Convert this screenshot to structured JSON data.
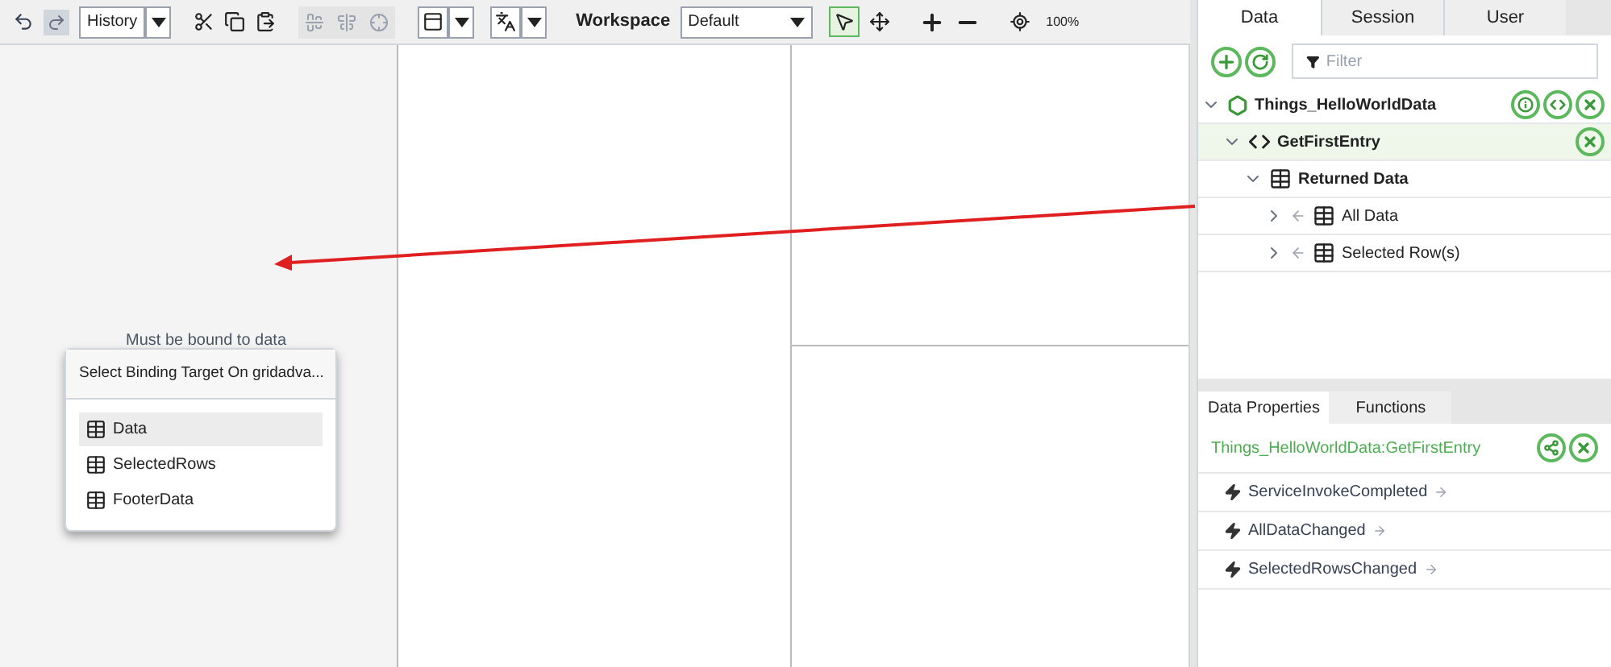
{
  "toolbar": {
    "history": "History",
    "workspace_label": "Workspace",
    "workspace": "Default",
    "zoom": "100%"
  },
  "canvas": {
    "grid_message": "Must be bound to data",
    "binding_popup": {
      "title": "Select Binding Target On gridadva...",
      "items": [
        {
          "label": "Data",
          "selected": true
        },
        {
          "label": "SelectedRows",
          "selected": false
        },
        {
          "label": "FooterData",
          "selected": false
        }
      ]
    }
  },
  "data_panel": {
    "tabs": [
      {
        "label": "Data",
        "selected": true
      },
      {
        "label": "Session",
        "selected": false
      },
      {
        "label": "User",
        "selected": false
      }
    ],
    "filter": {
      "placeholder": "Filter"
    },
    "tree": [
      {
        "label": "Things_HelloWorldData",
        "kind": "thing",
        "expanded": true,
        "children": [
          {
            "label": "GetFirstEntry",
            "kind": "service",
            "expanded": true,
            "children": [
              {
                "label": "Returned Data",
                "kind": "table",
                "expanded": true,
                "children": [
                  {
                    "label": "All Data",
                    "kind": "binding",
                    "expanded": false
                  },
                  {
                    "label": "Selected Row(s)",
                    "kind": "binding",
                    "expanded": false
                  }
                ]
              }
            ]
          }
        ]
      }
    ]
  },
  "properties_panel": {
    "tabs": [
      {
        "label": "Data Properties",
        "selected": true
      },
      {
        "label": "Functions",
        "selected": false
      }
    ],
    "source": "Things_HelloWorldData:GetFirstEntry",
    "events": [
      "ServiceInvokeCompleted",
      "AllDataChanged",
      "SelectedRowsChanged"
    ]
  }
}
